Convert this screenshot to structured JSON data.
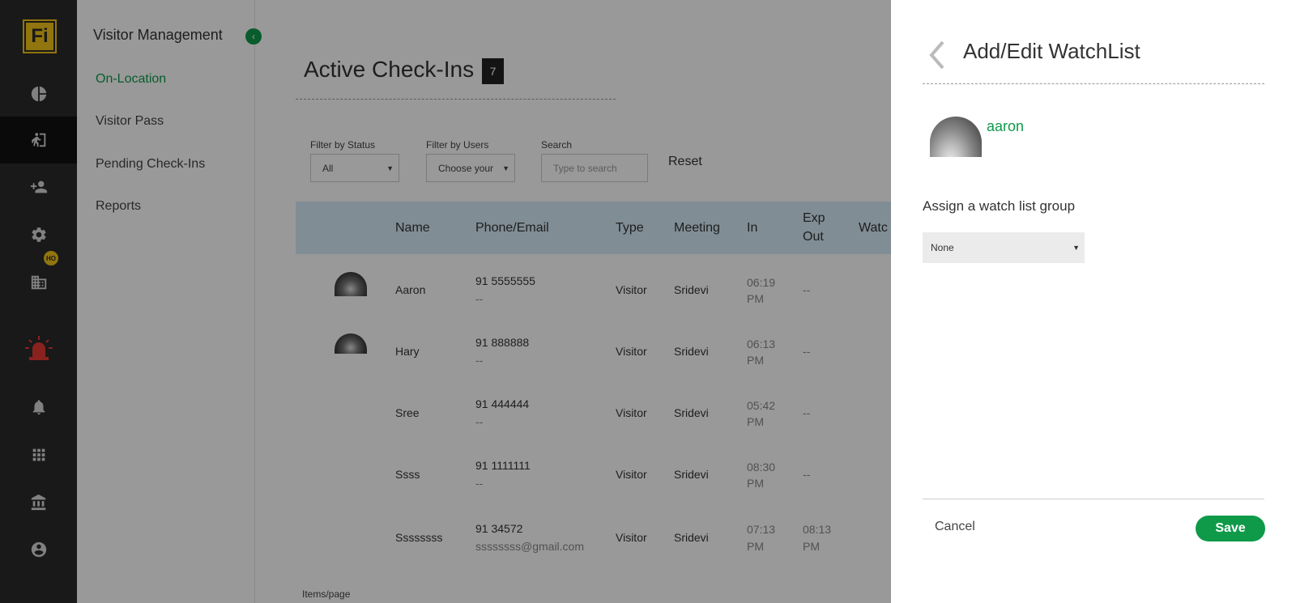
{
  "rail": {
    "logo_text": "Fi",
    "items": [
      {
        "icon": "pie-chart-icon"
      },
      {
        "icon": "visitor-walk-icon",
        "active": true
      },
      {
        "icon": "add-user-icon"
      },
      {
        "icon": "gear-icon"
      },
      {
        "icon": "building-icon",
        "badge": "HO"
      },
      {
        "icon": "alarm-siren-icon"
      },
      {
        "icon": "bell-icon"
      },
      {
        "icon": "apps-grid-icon"
      },
      {
        "icon": "bank-icon"
      },
      {
        "icon": "account-icon"
      }
    ]
  },
  "subnav": {
    "title": "Visitor Management",
    "items": [
      {
        "label": "On-Location",
        "active": true
      },
      {
        "label": "Visitor Pass"
      },
      {
        "label": "Pending Check-Ins"
      },
      {
        "label": "Reports"
      }
    ]
  },
  "main": {
    "title": "Active Check-Ins",
    "count": "7",
    "filters": {
      "status": {
        "label": "Filter by Status",
        "value": "All"
      },
      "users": {
        "label": "Filter by Users",
        "value": "Choose your"
      },
      "search": {
        "label": "Search",
        "placeholder": "Type to search"
      }
    },
    "reset_label": "Reset",
    "columns": [
      "Name",
      "Phone/Email",
      "Type",
      "Meeting",
      "In",
      "Exp\nOut",
      "Watc"
    ],
    "rows": [
      {
        "name": "Aaron",
        "phone": "91 5555555",
        "email": "--",
        "type": "Visitor",
        "meeting": "Sridevi",
        "in_time": "06:19",
        "in_ampm": "PM",
        "exp_out": "--",
        "exp_out_ampm": ""
      },
      {
        "name": "Hary",
        "phone": "91 888888",
        "email": "--",
        "type": "Visitor",
        "meeting": "Sridevi",
        "in_time": "06:13",
        "in_ampm": "PM",
        "exp_out": "--",
        "exp_out_ampm": ""
      },
      {
        "name": "Sree",
        "phone": "91 444444",
        "email": "--",
        "type": "Visitor",
        "meeting": "Sridevi",
        "in_time": "05:42",
        "in_ampm": "PM",
        "exp_out": "--",
        "exp_out_ampm": ""
      },
      {
        "name": "Ssss",
        "phone": "91 1111111",
        "email": "--",
        "type": "Visitor",
        "meeting": "Sridevi",
        "in_time": "08:30",
        "in_ampm": "PM",
        "exp_out": "--",
        "exp_out_ampm": ""
      },
      {
        "name": "Ssssssss",
        "phone": "91 34572",
        "email": "ssssssss@gmail.com",
        "type": "Visitor",
        "meeting": "Sridevi",
        "in_time": "07:13",
        "in_ampm": "PM",
        "exp_out": "08:13",
        "exp_out_ampm": "PM"
      }
    ],
    "items_per_page_label": "Items/page"
  },
  "drawer": {
    "title": "Add/Edit WatchList",
    "person_name": "aaron",
    "assign_label": "Assign a watch list group",
    "group_value": "None",
    "cancel_label": "Cancel",
    "save_label": "Save"
  },
  "colors": {
    "accent_green": "#0f9a4a",
    "rail_bg": "#2b2b2b",
    "logo_yellow": "#f2c318",
    "table_header": "#d6ecf8"
  }
}
